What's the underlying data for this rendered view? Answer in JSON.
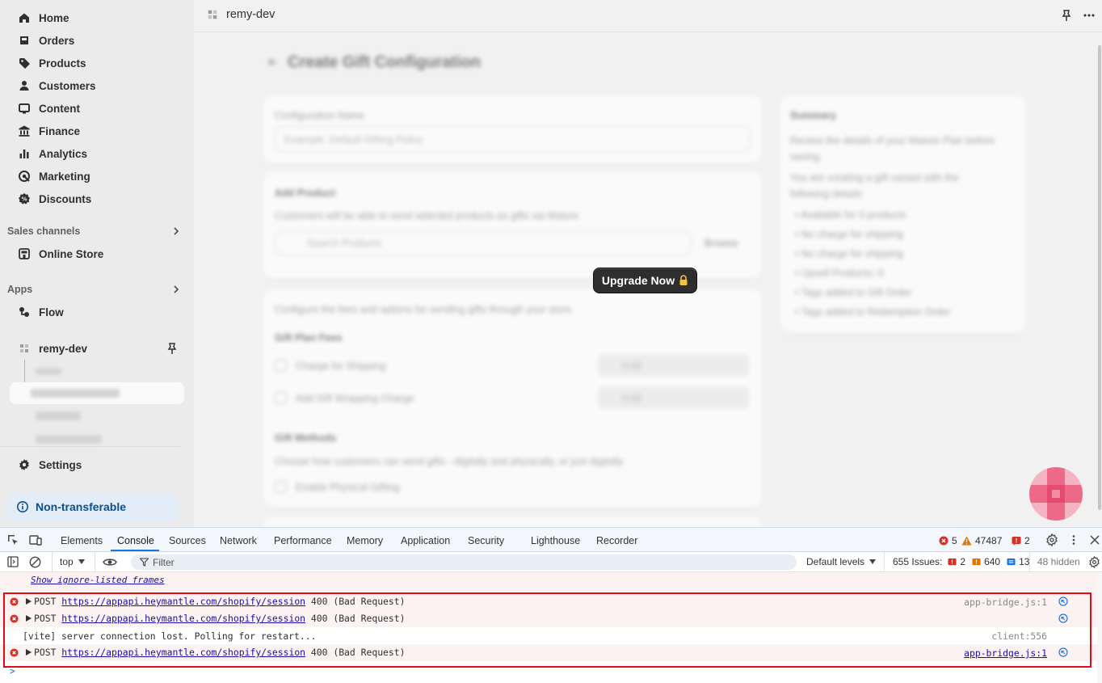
{
  "sidebar": {
    "items": [
      {
        "label": "Home",
        "icon": "home-icon"
      },
      {
        "label": "Orders",
        "icon": "orders-icon"
      },
      {
        "label": "Products",
        "icon": "tag-icon"
      },
      {
        "label": "Customers",
        "icon": "person-icon"
      },
      {
        "label": "Content",
        "icon": "content-icon"
      },
      {
        "label": "Finance",
        "icon": "bank-icon"
      },
      {
        "label": "Analytics",
        "icon": "bar-chart-icon"
      },
      {
        "label": "Marketing",
        "icon": "target-icon"
      },
      {
        "label": "Discounts",
        "icon": "discount-icon"
      }
    ],
    "sales_channels_label": "Sales channels",
    "online_store_label": "Online Store",
    "apps_label": "Apps",
    "flow_label": "Flow",
    "app_name": "remy-dev",
    "settings_label": "Settings",
    "non_transferable_label": "Non-transferable"
  },
  "topbar": {
    "app_name": "remy-dev"
  },
  "main": {
    "page_title": "Create Gift Configuration",
    "config_name_label": "Configuration Name",
    "config_name_placeholder": "Example: Default Gifting Policy",
    "add_product_title": "Add Product",
    "add_product_desc": "Customers will be able to send selected products as gifts via Mature",
    "search_products_placeholder": "Search Products",
    "browse_label": "Browse",
    "configure_desc": "Configure the fees and options for sending gifts through your store.",
    "gift_plan_fees_label": "Gift Plan Fees",
    "charge_shipping_label": "Charge for Shipping",
    "add_wrapping_label": "Add Gift Wrapping Charge",
    "fee_placeholder": "0.00",
    "gift_methods_label": "Gift Methods",
    "gift_methods_desc": "Choose how customers can send gifts - digitally and physically, or just digitally",
    "enable_physical_label": "Enable Physical Gifting",
    "summary_title": "Summary",
    "summary_desc1": "Review the details of your Mature Plan before saving.",
    "summary_desc2": "You are creating a gift variant with the following details:",
    "summary_items": [
      "Available for 0 products",
      "No charge for shipping",
      "No charge for shipping",
      "Upsell Products: 0",
      "Tags added to Gift Order",
      "Tags added to Redemption Order"
    ],
    "upgrade_button": "Upgrade Now"
  },
  "devtools": {
    "tabs": [
      "Elements",
      "Console",
      "Sources",
      "Network",
      "Performance",
      "Memory",
      "Application",
      "Security",
      "Lighthouse",
      "Recorder"
    ],
    "active_tab": "Console",
    "errors_count": "5",
    "warnings_count": "47487",
    "issues_badge_count": "2",
    "context_select": "top",
    "filter_placeholder": "Filter",
    "default_levels": "Default levels",
    "issues_label": "655 Issues:",
    "issues_errors": "2",
    "issues_warnings": "640",
    "issues_info": "13",
    "hidden_label": "48 hidden",
    "show_ignore_listed": "Show ignore-listed frames",
    "messages": [
      {
        "type": "error",
        "method": "POST",
        "url": "https://appapi.heymantle.com/shopify/session",
        "status": "400 (Bad Request)",
        "source": "app-bridge.js:1",
        "source_link": false
      },
      {
        "type": "error",
        "method": "POST",
        "url": "https://appapi.heymantle.com/shopify/session",
        "status": "400 (Bad Request)",
        "source": "",
        "source_link": false
      },
      {
        "type": "info",
        "text": "[vite] server connection lost. Polling for restart...",
        "source": "client:556"
      },
      {
        "type": "error",
        "method": "POST",
        "url": "https://appapi.heymantle.com/shopify/session",
        "status": "400 (Bad Request)",
        "source": "app-bridge.js:1",
        "source_link": true
      }
    ],
    "prompt": ">"
  },
  "colors": {
    "error_red": "#d93025",
    "highlight_box": "#e10b13",
    "active_tab": "#1a73e8",
    "upgrade_bg": "#2e2e2e",
    "non_transferable_bg": "#e3edf7"
  }
}
